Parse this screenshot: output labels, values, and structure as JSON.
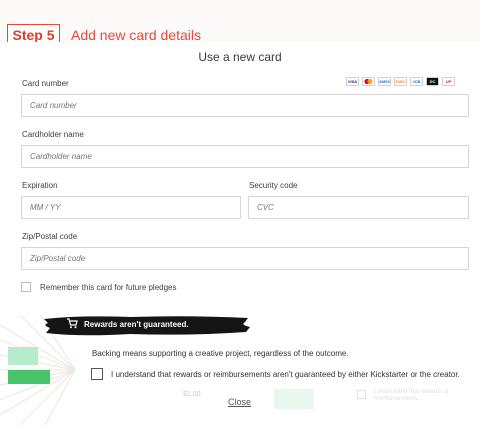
{
  "tutorial": {
    "step_label": "Step 5",
    "caption": "Add new card details"
  },
  "modal": {
    "title": "Use a new card",
    "card_number": {
      "label": "Card number",
      "placeholder": "Card number",
      "value": ""
    },
    "cardholder": {
      "label": "Cardholder name",
      "placeholder": "Cardholder name",
      "value": ""
    },
    "expiration": {
      "label": "Expiration",
      "placeholder": "MM / YY",
      "value": ""
    },
    "security": {
      "label": "Security code",
      "placeholder": "CVC",
      "value": ""
    },
    "zip": {
      "label": "Zip/Postal code",
      "placeholder": "Zip/Postal code",
      "value": ""
    },
    "card_brands": [
      {
        "name": "visa-icon",
        "text": "VISA",
        "color": "#1a1f71"
      },
      {
        "name": "mastercard-icon",
        "text": "",
        "color": "#eb001b"
      },
      {
        "name": "amex-icon",
        "text": "AMEX",
        "color": "#2e77bb"
      },
      {
        "name": "discover-icon",
        "text": "DISC",
        "color": "#f58220"
      },
      {
        "name": "jcb-icon",
        "text": "JCB",
        "color": "#0b6bb5"
      },
      {
        "name": "diners-icon",
        "text": "DC",
        "color": "#111111"
      },
      {
        "name": "unionpay-icon",
        "text": "UP",
        "color": "#d6202a"
      }
    ],
    "remember_label": "Remember this card for future pledges"
  },
  "rewards_notice": {
    "banner": "Rewards aren't guaranteed.",
    "description": "Backing means supporting a creative project, regardless of the outcome.",
    "agreement": "I understand that rewards or reimbursements aren't guaranteed by either Kickstarter or the creator."
  },
  "footer": {
    "faded_price": "$1.00",
    "faded_note": "I understand that rewards or reimbursements…",
    "close_label": "Close"
  },
  "colors": {
    "tutorial_accent": "#e04a3a",
    "kickstarter_green": "#49c46b"
  }
}
